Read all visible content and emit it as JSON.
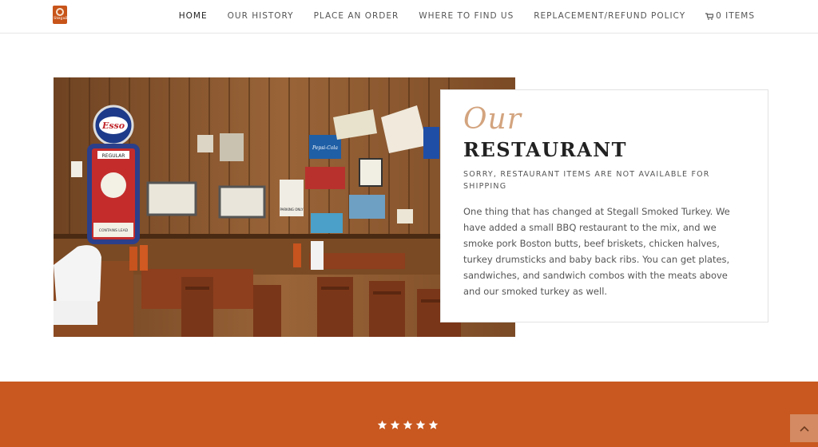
{
  "header": {
    "logo_text": "Stegall",
    "nav": [
      {
        "label": "HOME",
        "active": true
      },
      {
        "label": "OUR HISTORY"
      },
      {
        "label": "PLACE AN ORDER"
      },
      {
        "label": "WHERE TO FIND US"
      },
      {
        "label": "REPLACEMENT/REFUND POLICY"
      }
    ],
    "cart_label": "0 ITEMS",
    "cart_icon": "shopping-cart-icon"
  },
  "restaurant": {
    "script_title": "Our",
    "title": "RESTAURANT",
    "subtitle": "SORRY, RESTAURANT ITEMS ARE NOT AVAILABLE FOR SHIPPING",
    "body": "One thing that has changed at Stegall Smoked Turkey. We have added a small BBQ restaurant to the mix, and we smoke pork Boston butts, beef briskets, chicken halves, turkey drumsticks and baby back ribs. You can get plates, sandwiches, and sandwich combos with the meats above and our smoked turkey as well."
  },
  "photo": {
    "sign_esso": "Esso",
    "sign_regular": "REGULAR",
    "sign_lead": "CONTAINS LEAD",
    "sign_pepsi": "Pepsi-Cola",
    "sign_parking": "PARKING ONLY"
  },
  "reviews": {
    "rating": 5,
    "max": 5
  },
  "colors": {
    "accent": "#c8581f",
    "script": "#d3a47f",
    "scroll_button": "#d48a62"
  },
  "scroll_top_icon": "chevron-up-icon"
}
